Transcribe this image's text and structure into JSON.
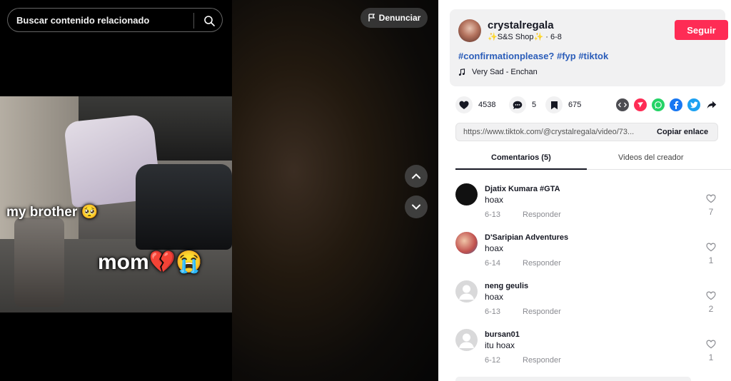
{
  "search": {
    "placeholder": "Buscar contenido relacionado"
  },
  "video": {
    "caption_brother": "my brother 🥺",
    "caption_mom": "mom💔😭",
    "report_label": "Denunciar"
  },
  "author": {
    "username": "crystalregala",
    "display_name": "✨S&S Shop✨",
    "separator": "·",
    "date": "6-8",
    "follow_label": "Seguir",
    "hashtags": "#confirmationplease? #fyp #tiktok",
    "music": "Very Sad - Enchan"
  },
  "stats": {
    "likes": "4538",
    "comments": "5",
    "saves": "675"
  },
  "share": {
    "link": "https://www.tiktok.com/@crystalregala/video/73...",
    "copy_label": "Copiar enlace"
  },
  "tabs": {
    "comments": "Comentarios (5)",
    "creator_videos": "Videos del creador"
  },
  "comments": [
    {
      "name": "Djatix Kumara #GTA",
      "text": "hoax",
      "date": "6-13",
      "reply": "Responder",
      "likes": "7"
    },
    {
      "name": "D'Saripian Adventures",
      "text": "hoax",
      "date": "6-14",
      "reply": "Responder",
      "likes": "1"
    },
    {
      "name": "neng geulis",
      "text": "hoax",
      "date": "6-13",
      "reply": "Responder",
      "likes": "2"
    },
    {
      "name": "bursan01",
      "text": "itu hoax",
      "date": "6-12",
      "reply": "Responder",
      "likes": "1"
    }
  ],
  "colors": {
    "accent": "#fe2c55",
    "hashtag": "#2b5db9",
    "panel_bg": "#f1f1f2"
  },
  "icons": [
    "search-icon",
    "flag-icon",
    "chevron-up-icon",
    "chevron-down-icon",
    "music-note-icon",
    "heart-icon",
    "comment-icon",
    "bookmark-icon",
    "embed-icon",
    "send-icon",
    "whatsapp-icon",
    "facebook-icon",
    "twitter-icon",
    "share-arrow-icon"
  ]
}
